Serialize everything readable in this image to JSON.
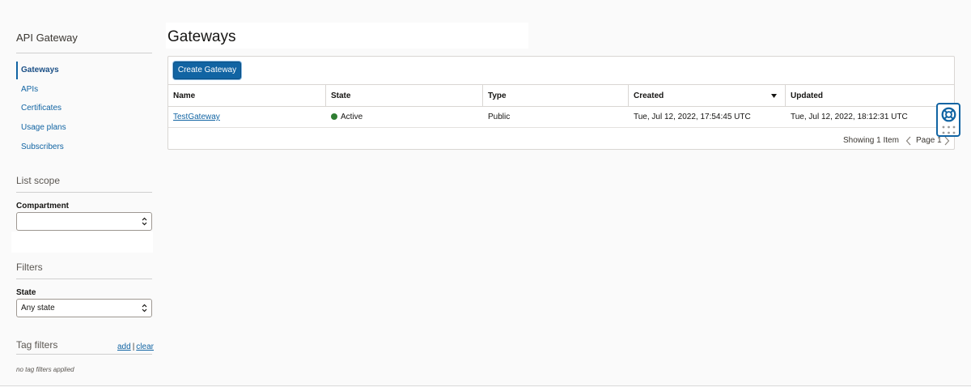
{
  "sidebar": {
    "title": "API Gateway",
    "nav": [
      {
        "label": "Gateways",
        "active": true
      },
      {
        "label": "APIs"
      },
      {
        "label": "Certificates"
      },
      {
        "label": "Usage plans"
      },
      {
        "label": "Subscribers"
      }
    ],
    "list_scope": {
      "heading": "List scope",
      "compartment_label": "Compartment",
      "compartment_value": ""
    },
    "filters": {
      "heading": "Filters",
      "state_label": "State",
      "state_value": "Any state"
    },
    "tag_filters": {
      "heading": "Tag filters",
      "add_label": "add",
      "separator": "|",
      "clear_label": "clear",
      "empty_text": "no tag filters applied"
    }
  },
  "main": {
    "title": "Gateways",
    "create_button": "Create Gateway",
    "table": {
      "columns": [
        "Name",
        "State",
        "Type",
        "Created",
        "Updated"
      ],
      "sorted_column": "Created",
      "rows": [
        {
          "name": "TestGateway",
          "state": "Active",
          "type": "Public",
          "created": "Tue, Jul 12, 2022, 17:54:45 UTC",
          "updated": "Tue, Jul 12, 2022, 18:12:31 UTC"
        }
      ]
    },
    "footer": {
      "showing": "Showing 1 Item",
      "page_label": "Page 1"
    }
  },
  "colors": {
    "accent": "#1164a3",
    "active_status": "#2f7d32"
  },
  "icons": {
    "sort": "caret-down-icon",
    "select": "chevron-updown-icon",
    "pager_prev": "chevron-left-icon",
    "pager_next": "chevron-right-icon",
    "help": "lifebuoy-icon",
    "grip": "grip-dots-icon"
  }
}
